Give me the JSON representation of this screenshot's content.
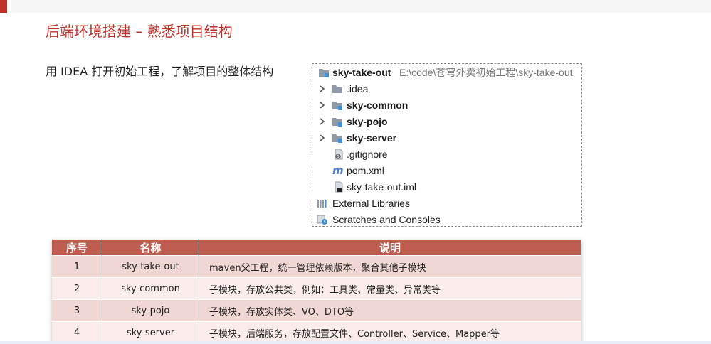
{
  "slide": {
    "title": "后端环境搭建 – 熟悉项目结构",
    "subtitle": "用 IDEA 打开初始工程，了解项目的整体结构"
  },
  "tree": {
    "root": {
      "name": "sky-take-out",
      "path": "E:\\code\\苍穹外卖初始工程\\sky-take-out",
      "icon": "module-folder-icon"
    },
    "items": [
      {
        "label": ".idea",
        "icon": "folder-icon",
        "expandable": true,
        "bold": false
      },
      {
        "label": "sky-common",
        "icon": "module-folder-icon",
        "expandable": true,
        "bold": true
      },
      {
        "label": "sky-pojo",
        "icon": "module-folder-icon",
        "expandable": true,
        "bold": true
      },
      {
        "label": "sky-server",
        "icon": "module-folder-icon",
        "expandable": true,
        "bold": true
      },
      {
        "label": ".gitignore",
        "icon": "gitignore-file-icon",
        "expandable": false,
        "bold": false
      },
      {
        "label": "pom.xml",
        "icon": "maven-icon",
        "expandable": false,
        "bold": false
      },
      {
        "label": "sky-take-out.iml",
        "icon": "iml-file-icon",
        "expandable": false,
        "bold": false
      }
    ],
    "external_libraries": "External Libraries",
    "scratches": "Scratches and Consoles"
  },
  "table": {
    "headers": [
      "序号",
      "名称",
      "说明"
    ],
    "rows": [
      [
        "1",
        "sky-take-out",
        "maven父工程，统一管理依赖版本，聚合其他子模块"
      ],
      [
        "2",
        "sky-common",
        "子模块，存放公共类，例如：工具类、常量类、异常类等"
      ],
      [
        "3",
        "sky-pojo",
        "子模块，存放实体类、VO、DTO等"
      ],
      [
        "4",
        "sky-server",
        "子模块，后端服务，存放配置文件、Controller、Service、Mapper等"
      ]
    ]
  },
  "colors": {
    "title": "#c0312a",
    "table_header": "#bd5c4f",
    "row_odd": "#f0d7d4",
    "row_even": "#f9ecea"
  }
}
